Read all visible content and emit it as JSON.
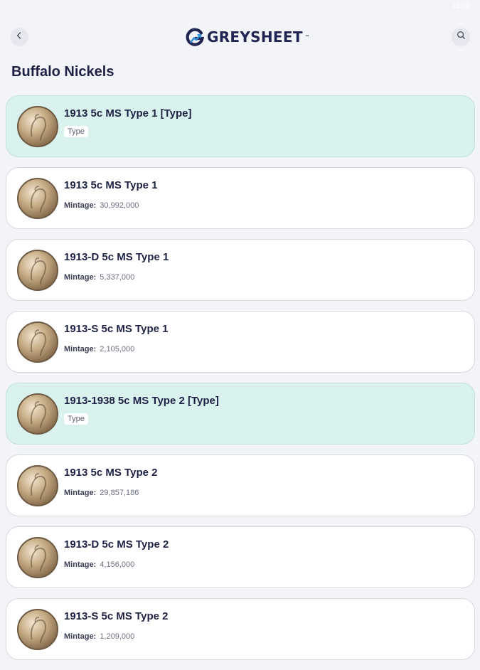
{
  "status_bar": {
    "time": "12:00"
  },
  "header": {
    "back_icon": "chevron-left-icon",
    "logo_text": "GREYSHEET",
    "logo_tm": "™",
    "search_icon": "search-icon"
  },
  "page": {
    "title": "Buffalo Nickels"
  },
  "coins": [
    {
      "name": "1913 5c MS Type 1 [Type]",
      "badge": "Type",
      "is_type": true
    },
    {
      "name": "1913 5c MS Type 1",
      "mintage_label": "Mintage:",
      "mintage": "30,992,000",
      "is_type": false
    },
    {
      "name": "1913-D 5c MS Type 1",
      "mintage_label": "Mintage:",
      "mintage": "5,337,000",
      "is_type": false
    },
    {
      "name": "1913-S 5c MS Type 1",
      "mintage_label": "Mintage:",
      "mintage": "2,105,000",
      "is_type": false
    },
    {
      "name": "1913-1938 5c MS Type 2 [Type]",
      "badge": "Type",
      "is_type": true
    },
    {
      "name": "1913 5c MS Type 2",
      "mintage_label": "Mintage:",
      "mintage": "29,857,186",
      "is_type": false
    },
    {
      "name": "1913-D 5c MS Type 2",
      "mintage_label": "Mintage:",
      "mintage": "4,156,000",
      "is_type": false
    },
    {
      "name": "1913-S 5c MS Type 2",
      "mintage_label": "Mintage:",
      "mintage": "1,209,000",
      "is_type": false
    }
  ],
  "colors": {
    "background": "#f3f4f8",
    "card": "#ffffff",
    "type_card": "#d9f2ee",
    "text_dark": "#1d2244",
    "brand_navy": "#1f2451",
    "brand_blue": "#3a8fd6"
  }
}
